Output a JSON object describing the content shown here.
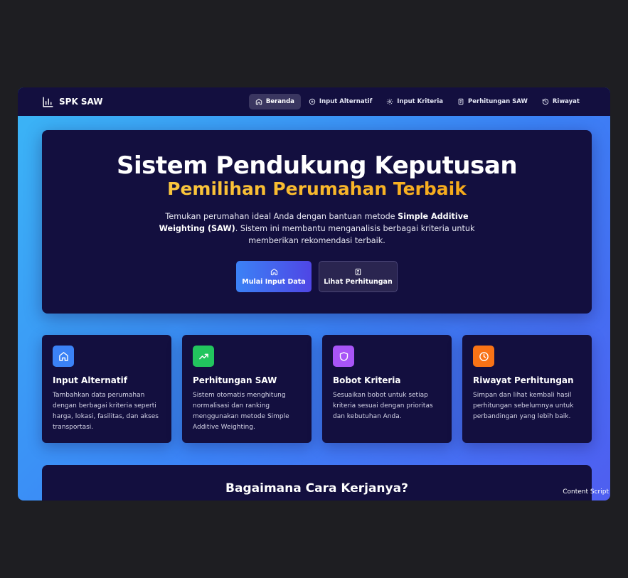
{
  "brand": {
    "name": "SPK SAW",
    "icon": "bar-chart-icon"
  },
  "nav": [
    {
      "label": "Beranda",
      "icon": "home-icon",
      "active": true
    },
    {
      "label": "Input Alternatif",
      "icon": "plus-circle-icon",
      "active": false
    },
    {
      "label": "Input Kriteria",
      "icon": "gear-icon",
      "active": false
    },
    {
      "label": "Perhitungan SAW",
      "icon": "document-icon",
      "active": false
    },
    {
      "label": "Riwayat",
      "icon": "history-icon",
      "active": false
    }
  ],
  "hero": {
    "title": "Sistem Pendukung Keputusan",
    "subtitle": "Pemilihan Perumahan Terbaik",
    "desc_before": "Temukan perumahan ideal Anda dengan bantuan metode ",
    "desc_bold": "Simple Additive Weighting (SAW)",
    "desc_after": ". Sistem ini membantu menganalisis berbagai kriteria untuk memberikan rekomendasi terbaik.",
    "primary_button": "Mulai Input Data",
    "secondary_button": "Lihat Perhitungan"
  },
  "cards": [
    {
      "title": "Input Alternatif",
      "desc": "Tambahkan data perumahan dengan berbagai kriteria seperti harga, lokasi, fasilitas, dan akses transportasi.",
      "icon": "home-icon",
      "color": "#3b82f6"
    },
    {
      "title": "Perhitungan SAW",
      "desc": "Sistem otomatis menghitung normalisasi dan ranking menggunakan metode Simple Additive Weighting.",
      "icon": "trending-up-icon",
      "color": "#22c55e"
    },
    {
      "title": "Bobot Kriteria",
      "desc": "Sesuaikan bobot untuk setiap kriteria sesuai dengan prioritas dan kebutuhan Anda.",
      "icon": "shield-icon",
      "color": "#a855f7"
    },
    {
      "title": "Riwayat Perhitungan",
      "desc": "Simpan dan lihat kembali hasil perhitungan sebelumnya untuk perbandingan yang lebih baik.",
      "icon": "clock-icon",
      "color": "#f97316"
    }
  ],
  "how": {
    "title": "Bagaimana Cara Kerjanya?"
  },
  "overlay": {
    "label": "Content Script"
  }
}
